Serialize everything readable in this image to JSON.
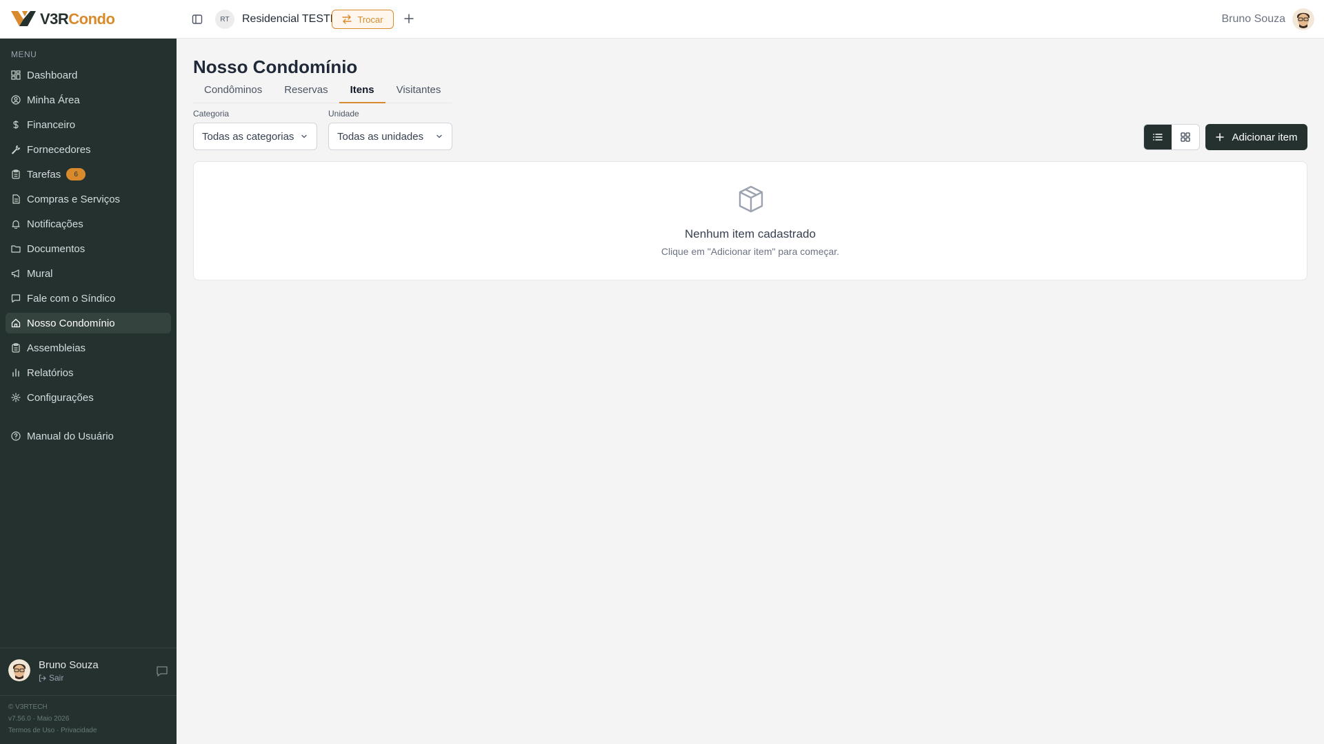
{
  "header": {
    "logo_part1": "V3R",
    "logo_part2": "Condo",
    "condo_initials": "RT",
    "condo_name": "Residencial TESTE",
    "switch_label": "Trocar",
    "user_name": "Bruno Souza"
  },
  "sidebar": {
    "menu_label": "MENU",
    "items": [
      {
        "label": "Dashboard",
        "icon": "dashboard-icon"
      },
      {
        "label": "Minha Área",
        "icon": "user-circle-icon"
      },
      {
        "label": "Financeiro",
        "icon": "dollar-icon"
      },
      {
        "label": "Fornecedores",
        "icon": "wrench-icon"
      },
      {
        "label": "Tarefas",
        "icon": "clipboard-icon",
        "badge": "6"
      },
      {
        "label": "Compras e Serviços",
        "icon": "document-icon"
      },
      {
        "label": "Notificações",
        "icon": "bell-icon"
      },
      {
        "label": "Documentos",
        "icon": "folder-icon"
      },
      {
        "label": "Mural",
        "icon": "megaphone-icon"
      },
      {
        "label": "Fale com o Síndico",
        "icon": "chat-icon"
      },
      {
        "label": "Nosso Condomínio",
        "icon": "home-icon",
        "active": true
      },
      {
        "label": "Assembleias",
        "icon": "clipboard-icon"
      },
      {
        "label": "Relatórios",
        "icon": "bar-chart-icon"
      },
      {
        "label": "Configurações",
        "icon": "gear-icon"
      }
    ],
    "manual_label": "Manual do Usuário",
    "user_name": "Bruno Souza",
    "logout_label": "Sair",
    "footer": {
      "copyright": "© V3RTECH",
      "version": "v7.56.0 · Maio 2026",
      "terms": "Termos de Uso",
      "privacy": "Privacidade"
    }
  },
  "main": {
    "title": "Nosso Condomínio",
    "tabs": [
      {
        "label": "Condôminos"
      },
      {
        "label": "Reservas"
      },
      {
        "label": "Itens",
        "active": true
      },
      {
        "label": "Visitantes"
      }
    ],
    "filters": {
      "category_label": "Categoria",
      "category_value": "Todas as categorias",
      "unit_label": "Unidade",
      "unit_value": "Todas as unidades"
    },
    "add_button": "Adicionar item",
    "empty": {
      "title": "Nenhum item cadastrado",
      "subtitle": "Clique em \"Adicionar item\" para começar."
    }
  },
  "colors": {
    "sidebar_bg": "#24312f",
    "accent": "#d98a2c",
    "page_bg": "#f4f4f5"
  }
}
